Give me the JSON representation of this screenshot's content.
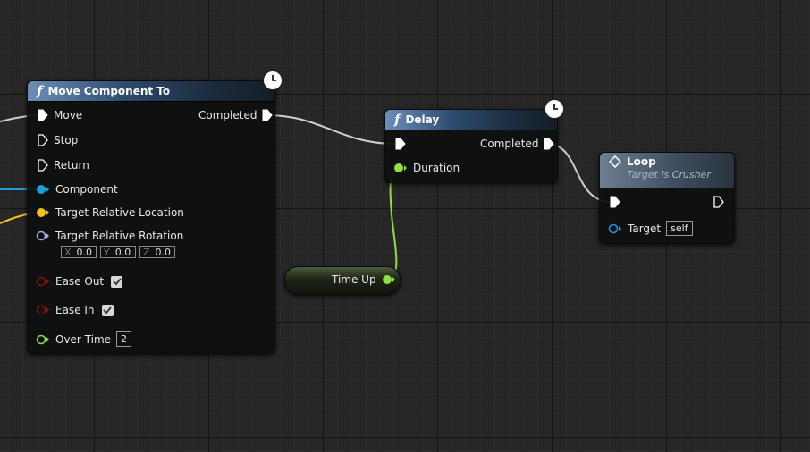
{
  "nodes": {
    "move_component": {
      "title": "Move Component To",
      "pins": {
        "move": "Move",
        "stop": "Stop",
        "return": "Return",
        "component": "Component",
        "target_location": "Target Relative Location",
        "target_rotation": "Target Relative Rotation",
        "ease_out": "Ease Out",
        "ease_in": "Ease In",
        "over_time": "Over Time",
        "completed": "Completed"
      },
      "rotation": {
        "x_label": "X",
        "x": "0.0",
        "y_label": "Y",
        "y": "0.0",
        "z_label": "Z",
        "z": "0.0"
      },
      "ease_out_checked": true,
      "ease_in_checked": true,
      "over_time_value": "2"
    },
    "delay": {
      "title": "Delay",
      "pins": {
        "duration": "Duration",
        "completed": "Completed"
      }
    },
    "loop": {
      "title": "Loop",
      "subtitle": "Target is Crusher",
      "pins": {
        "target": "Target"
      },
      "target_value": "self"
    },
    "time_up": {
      "label": "Time Up"
    }
  },
  "colors": {
    "exec": "#ffffff",
    "object": "#1d9ce0",
    "vector": "#f6c21c",
    "rotator": "#a6acde",
    "bool": "#8a1010",
    "float": "#8ee045",
    "wire_exec": "#d0d0d0"
  }
}
